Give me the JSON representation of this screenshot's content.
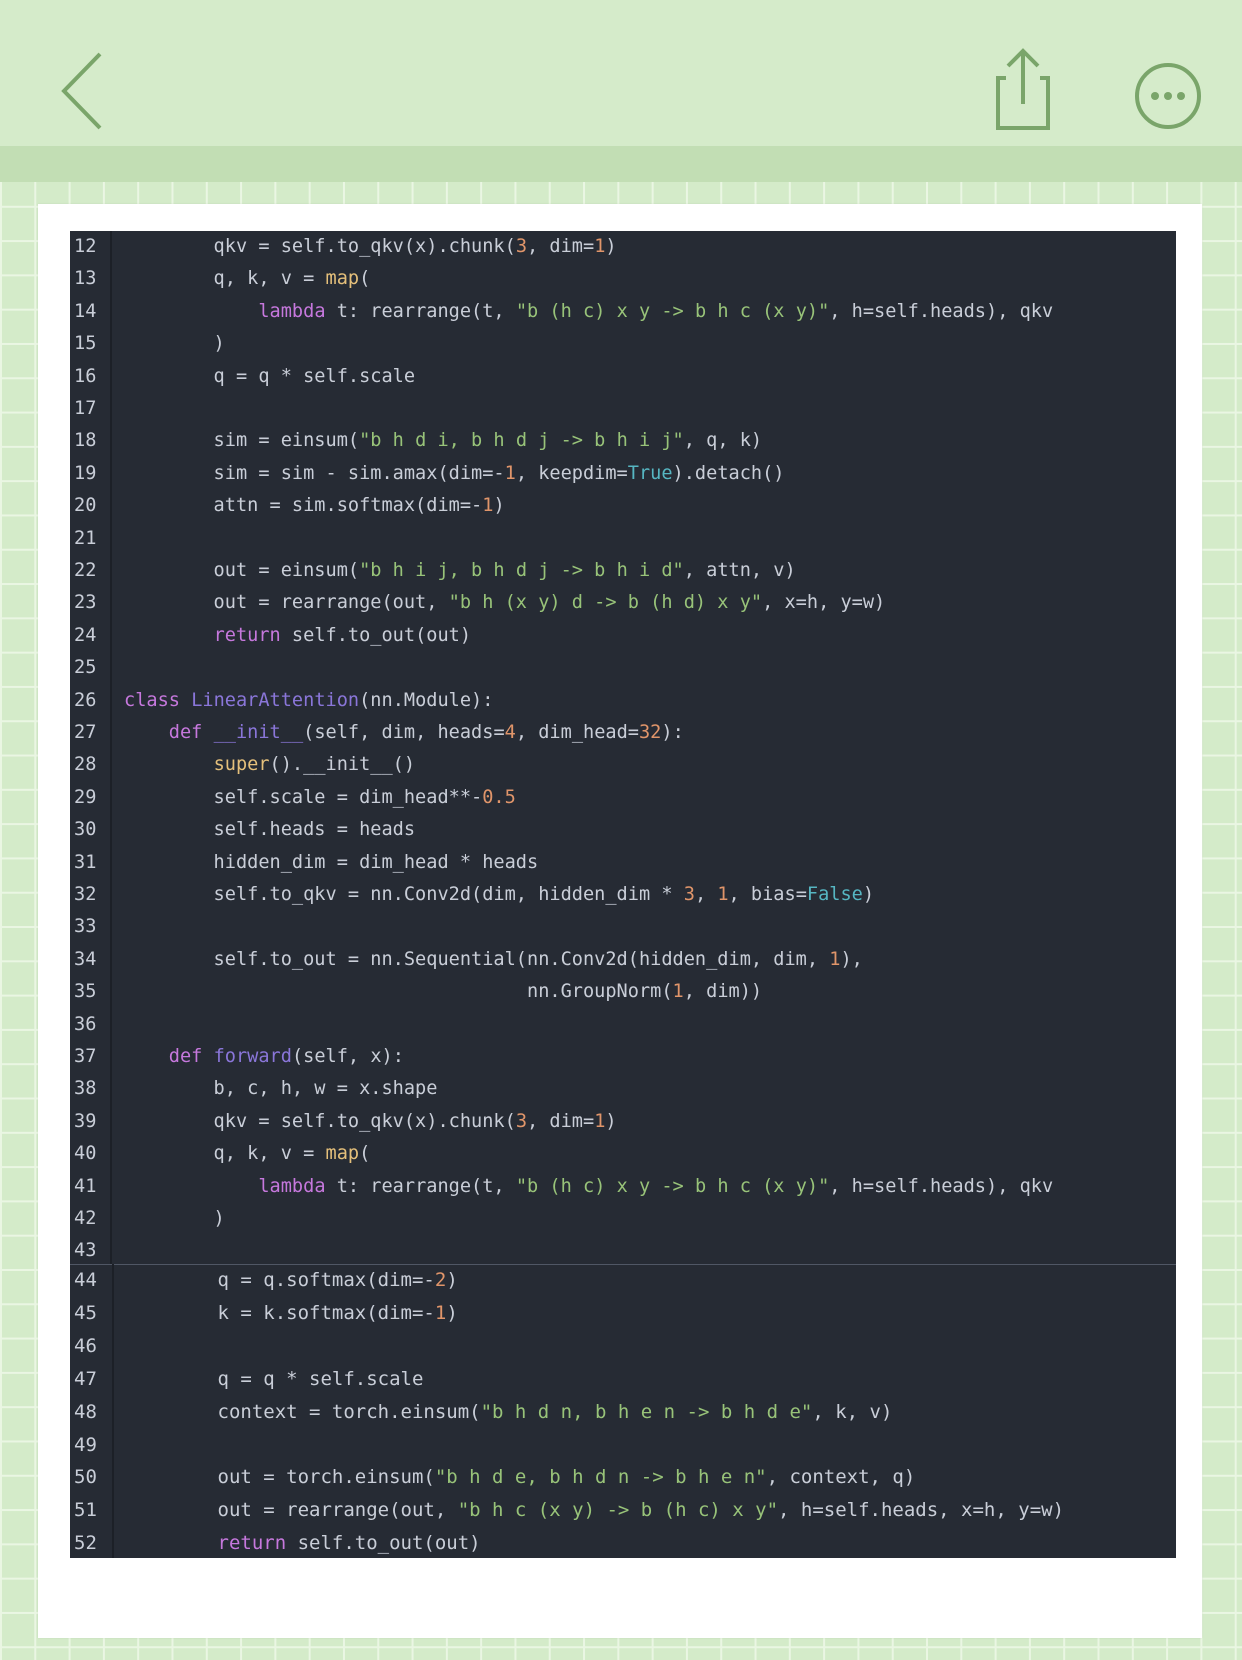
{
  "toolbar": {
    "back_icon": "chevron-left-icon",
    "share_icon": "share-upload-icon",
    "more_icon": "more-dots-icon",
    "accent_color": "#7aa56a"
  },
  "code_blocks": [
    {
      "lines": [
        {
          "n": "12",
          "tokens": [
            [
              "pln",
              "        qkv = self.to_qkv(x).chunk("
            ],
            [
              "num",
              "3"
            ],
            [
              "pln",
              ", dim="
            ],
            [
              "num",
              "1"
            ],
            [
              "pln",
              ")"
            ]
          ]
        },
        {
          "n": "13",
          "tokens": [
            [
              "pln",
              "        q, k, v = "
            ],
            [
              "fn",
              "map"
            ],
            [
              "pln",
              "("
            ]
          ]
        },
        {
          "n": "14",
          "tokens": [
            [
              "pln",
              "            "
            ],
            [
              "kw",
              "lambda"
            ],
            [
              "pln",
              " t: rearrange(t, "
            ],
            [
              "str",
              "\"b (h c) x y -> b h c (x y)\""
            ],
            [
              "pln",
              ", h=self.heads), qkv"
            ]
          ]
        },
        {
          "n": "15",
          "tokens": [
            [
              "pln",
              "        )"
            ]
          ]
        },
        {
          "n": "16",
          "tokens": [
            [
              "pln",
              "        q = q * self.scale"
            ]
          ]
        },
        {
          "n": "17",
          "tokens": []
        },
        {
          "n": "18",
          "tokens": [
            [
              "pln",
              "        sim = einsum("
            ],
            [
              "str",
              "\"b h d i, b h d j -> b h i j\""
            ],
            [
              "pln",
              ", q, k)"
            ]
          ]
        },
        {
          "n": "19",
          "tokens": [
            [
              "pln",
              "        sim = sim - sim.amax(dim=-"
            ],
            [
              "num",
              "1"
            ],
            [
              "pln",
              ", keepdim="
            ],
            [
              "bool",
              "True"
            ],
            [
              "pln",
              ").detach()"
            ]
          ]
        },
        {
          "n": "20",
          "tokens": [
            [
              "pln",
              "        attn = sim.softmax(dim=-"
            ],
            [
              "num",
              "1"
            ],
            [
              "pln",
              ")"
            ]
          ]
        },
        {
          "n": "21",
          "tokens": []
        },
        {
          "n": "22",
          "tokens": [
            [
              "pln",
              "        out = einsum("
            ],
            [
              "str",
              "\"b h i j, b h d j -> b h i d\""
            ],
            [
              "pln",
              ", attn, v)"
            ]
          ]
        },
        {
          "n": "23",
          "tokens": [
            [
              "pln",
              "        out = rearrange(out, "
            ],
            [
              "str",
              "\"b h (x y) d -> b (h d) x y\""
            ],
            [
              "pln",
              ", x=h, y=w)"
            ]
          ]
        },
        {
          "n": "24",
          "tokens": [
            [
              "pln",
              "        "
            ],
            [
              "kw",
              "return"
            ],
            [
              "pln",
              " self.to_out(out)"
            ]
          ]
        },
        {
          "n": "25",
          "tokens": []
        },
        {
          "n": "26",
          "tokens": [
            [
              "kw",
              "class"
            ],
            [
              "pln",
              " "
            ],
            [
              "cls",
              "LinearAttention"
            ],
            [
              "pln",
              "(nn.Module):"
            ]
          ]
        },
        {
          "n": "27",
          "tokens": [
            [
              "pln",
              "    "
            ],
            [
              "kw",
              "def"
            ],
            [
              "pln",
              " "
            ],
            [
              "cls",
              "__init__"
            ],
            [
              "pln",
              "(self, dim, heads="
            ],
            [
              "num",
              "4"
            ],
            [
              "pln",
              ", dim_head="
            ],
            [
              "num",
              "32"
            ],
            [
              "pln",
              "):"
            ]
          ]
        },
        {
          "n": "28",
          "tokens": [
            [
              "pln",
              "        "
            ],
            [
              "fn",
              "super"
            ],
            [
              "pln",
              "().__init__()"
            ]
          ]
        },
        {
          "n": "29",
          "tokens": [
            [
              "pln",
              "        self.scale = dim_head**-"
            ],
            [
              "num",
              "0.5"
            ]
          ]
        },
        {
          "n": "30",
          "tokens": [
            [
              "pln",
              "        self.heads = heads"
            ]
          ]
        },
        {
          "n": "31",
          "tokens": [
            [
              "pln",
              "        hidden_dim = dim_head * heads"
            ]
          ]
        },
        {
          "n": "32",
          "tokens": [
            [
              "pln",
              "        self.to_qkv = nn.Conv2d(dim, hidden_dim * "
            ],
            [
              "num",
              "3"
            ],
            [
              "pln",
              ", "
            ],
            [
              "num",
              "1"
            ],
            [
              "pln",
              ", bias="
            ],
            [
              "bool",
              "False"
            ],
            [
              "pln",
              ")"
            ]
          ]
        },
        {
          "n": "33",
          "tokens": []
        },
        {
          "n": "34",
          "tokens": [
            [
              "pln",
              "        self.to_out = nn.Sequential(nn.Conv2d(hidden_dim, dim, "
            ],
            [
              "num",
              "1"
            ],
            [
              "pln",
              "),"
            ]
          ]
        },
        {
          "n": "35",
          "tokens": [
            [
              "pln",
              "                                    nn.GroupNorm("
            ],
            [
              "num",
              "1"
            ],
            [
              "pln",
              ", dim))"
            ]
          ]
        },
        {
          "n": "36",
          "tokens": []
        },
        {
          "n": "37",
          "tokens": [
            [
              "pln",
              "    "
            ],
            [
              "kw",
              "def"
            ],
            [
              "pln",
              " "
            ],
            [
              "cls",
              "forward"
            ],
            [
              "pln",
              "(self, x):"
            ]
          ]
        },
        {
          "n": "38",
          "tokens": [
            [
              "pln",
              "        b, c, h, w = x.shape"
            ]
          ]
        },
        {
          "n": "39",
          "tokens": [
            [
              "pln",
              "        qkv = self.to_qkv(x).chunk("
            ],
            [
              "num",
              "3"
            ],
            [
              "pln",
              ", dim="
            ],
            [
              "num",
              "1"
            ],
            [
              "pln",
              ")"
            ]
          ]
        },
        {
          "n": "40",
          "tokens": [
            [
              "pln",
              "        q, k, v = "
            ],
            [
              "fn",
              "map"
            ],
            [
              "pln",
              "("
            ]
          ]
        },
        {
          "n": "41",
          "tokens": [
            [
              "pln",
              "            "
            ],
            [
              "kw",
              "lambda"
            ],
            [
              "pln",
              " t: rearrange(t, "
            ],
            [
              "str",
              "\"b (h c) x y -> b h c (x y)\""
            ],
            [
              "pln",
              ", h=self.heads), qkv"
            ]
          ]
        },
        {
          "n": "42",
          "tokens": [
            [
              "pln",
              "        )"
            ]
          ]
        },
        {
          "n": "43",
          "tokens": []
        }
      ]
    },
    {
      "lines": [
        {
          "n": "44",
          "tokens": [
            [
              "pln",
              "        q = q.softmax(dim=-"
            ],
            [
              "num",
              "2"
            ],
            [
              "pln",
              ")"
            ]
          ]
        },
        {
          "n": "45",
          "tokens": [
            [
              "pln",
              "        k = k.softmax(dim=-"
            ],
            [
              "num",
              "1"
            ],
            [
              "pln",
              ")"
            ]
          ]
        },
        {
          "n": "46",
          "tokens": []
        },
        {
          "n": "47",
          "tokens": [
            [
              "pln",
              "        q = q * self.scale"
            ]
          ]
        },
        {
          "n": "48",
          "tokens": [
            [
              "pln",
              "        context = torch.einsum("
            ],
            [
              "str",
              "\"b h d n, b h e n -> b h d e\""
            ],
            [
              "pln",
              ", k, v)"
            ]
          ]
        },
        {
          "n": "49",
          "tokens": []
        },
        {
          "n": "50",
          "tokens": [
            [
              "pln",
              "        out = torch.einsum("
            ],
            [
              "str",
              "\"b h d e, b h d n -> b h e n\""
            ],
            [
              "pln",
              ", context, q)"
            ]
          ]
        },
        {
          "n": "51",
          "tokens": [
            [
              "pln",
              "        out = rearrange(out, "
            ],
            [
              "str",
              "\"b h c (x y) -> b (h c) x y\""
            ],
            [
              "pln",
              ", h=self.heads, x=h, y=w)"
            ]
          ]
        },
        {
          "n": "52",
          "tokens": [
            [
              "pln",
              "        "
            ],
            [
              "kw",
              "return"
            ],
            [
              "pln",
              " self.to_out(out)"
            ]
          ]
        }
      ]
    }
  ]
}
